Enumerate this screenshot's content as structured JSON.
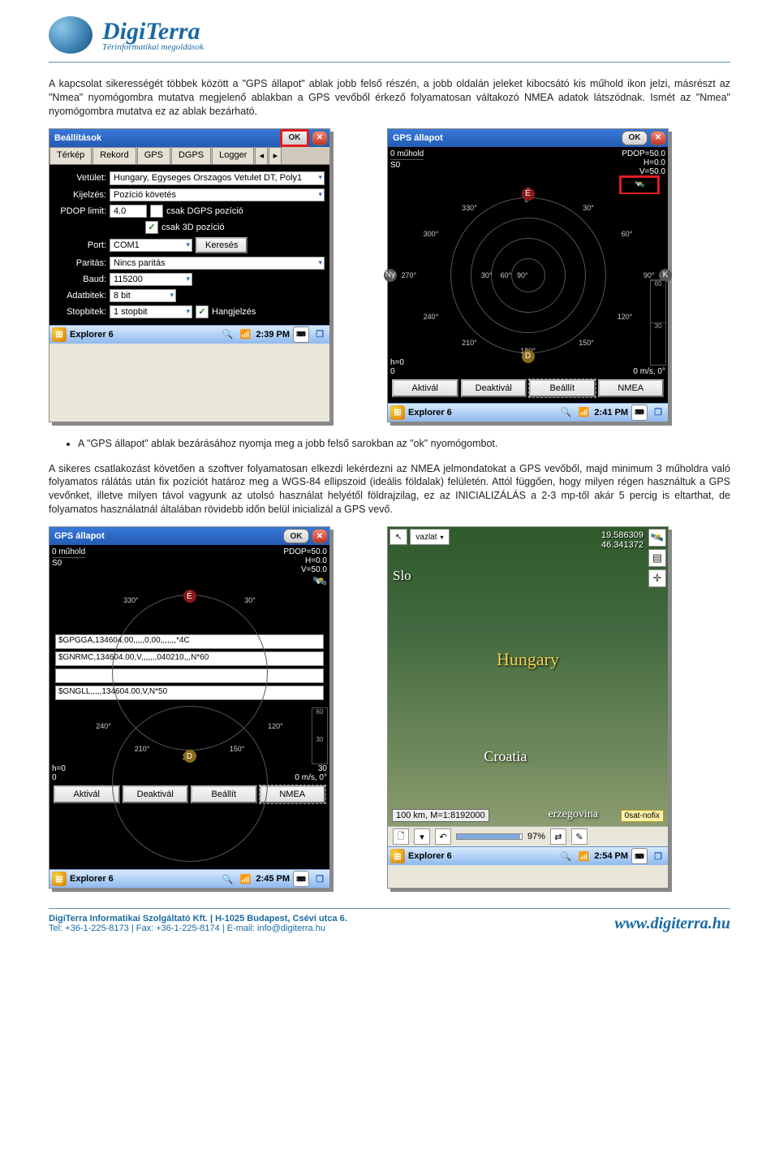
{
  "logo": {
    "title": "DigiTerra",
    "subtitle": "Térinformatikai megoldások"
  },
  "para1": "A kapcsolat sikerességét többek között a \"GPS állapot\" ablak jobb felső részén, a jobb oldalán jeleket kibocsátó kis műhold ikon jelzi, másrészt az \"Nmea\" nyomógombra mutatva megjelenő ablakban a GPS vevőből érkező folyamatosan váltakozó NMEA adatok látszódnak. Ismét az \"Nmea\" nyomógombra mutatva ez az ablak bezárható.",
  "bullet1": "A \"GPS állapot\" ablak bezárásához nyomja meg a jobb felső sarokban az \"ok\" nyomógombot.",
  "para2": "A sikeres csatlakozást követően a szoftver folyamatosan elkezdi lekérdezni az NMEA jelmondatokat a GPS vevőből, majd minimum 3 műholdra való folyamatos rálátás után fix pozíciót határoz meg a WGS-84 ellipszoid (ideális földalak) felületén. Attól függően, hogy milyen régen használtuk a GPS vevőnket, illetve milyen távol vagyunk az utolsó használat helyétől földrajzilag, ez az INICIALIZÁLÁS a 2-3 mp-től akár 5 percig is eltarthat, de folyamatos használatnál általában rövidebb időn belül inicializál a GPS vevő.",
  "settings": {
    "title": "Beállítások",
    "ok": "OK",
    "tabs": [
      "Térkép",
      "Rekord",
      "GPS",
      "DGPS",
      "Logger"
    ],
    "labels": {
      "vetulet": "Vetület:",
      "kijelzes": "Kijelzés:",
      "pdop": "PDOP limit:",
      "port": "Port:",
      "paritas": "Paritás:",
      "baud": "Baud:",
      "adatbitek": "Adatbitek:",
      "stopbitek": "Stopbitek:"
    },
    "values": {
      "vetulet": "Hungary, Egyseges Orszagos Vetulet DT, Poly1",
      "kijelzes": "Pozíció követés",
      "pdop": "4.0",
      "csak_dgps": "csak DGPS pozíció",
      "csak_3d": "csak 3D pozíció",
      "port": "COM1",
      "kereses": "Keresés",
      "paritas": "Nincs paritás",
      "baud": "115200",
      "adatbitek": "8 bit",
      "stopbitek": "1 stopbit",
      "hangjelzes": "Hangjelzés"
    },
    "task": {
      "app": "Explorer 6",
      "time": "2:39 PM"
    }
  },
  "gps1": {
    "title": "GPS állapot",
    "ok": "OK",
    "top": {
      "muhold": "0 műhold",
      "pdop": "PDOP=50.0",
      "h": "H=0.0",
      "s0": "S0",
      "v": "V=50.0"
    },
    "angles": {
      "outer": [
        "330°",
        "0°",
        "30°",
        "300°",
        "60°",
        "270°",
        "90°",
        "240°",
        "120°",
        "210°",
        "180°",
        "150°"
      ],
      "inner": [
        "30°",
        "60°",
        "90°"
      ]
    },
    "cardinals": {
      "n": "É",
      "s": "D",
      "e": "K",
      "w": "Ny"
    },
    "sig": {
      "top": "60",
      "bot": "30"
    },
    "bot": {
      "h0": "h=0",
      "zero1": "0",
      "zero2": "0",
      "speed": "0 m/s, 0°",
      "bar30": "30"
    },
    "buttons": {
      "aktival": "Aktivál",
      "deaktival": "Deaktivál",
      "beallit": "Beállít",
      "nmea": "NMEA"
    },
    "task": {
      "app": "Explorer 6",
      "time": "2:41 PM"
    }
  },
  "gps2": {
    "title": "GPS állapot",
    "ok": "OK",
    "top": {
      "muhold": "0 műhold",
      "pdop": "PDOP=50.0",
      "h": "H=0.0",
      "s0": "S0",
      "v": "V=50.0"
    },
    "nmea": {
      "l1": "$GPGGA,134604.00,,,,,0,00,,,,,,,*4C",
      "l2": "$GNRMC,134604.00,V,,,,,,,040210,,,N*60",
      "l3": "",
      "l4": "$GNGLL,,,,,134604.00,V,N*50"
    },
    "partial_angles": [
      "240°",
      "180°",
      "120°",
      "210°",
      "150°"
    ],
    "bot": {
      "h0": "h=0",
      "zero1": "0",
      "zero2": "0",
      "speed": "0 m/s, 0°",
      "bar30": "30"
    },
    "buttons": {
      "aktival": "Aktivál",
      "deaktival": "Deaktivál",
      "beallit": "Beállít",
      "nmea": "NMEA"
    },
    "task": {
      "app": "Explorer 6",
      "time": "2:45 PM"
    }
  },
  "map": {
    "layer": "vazlat",
    "coords": {
      "lon": "19.586309",
      "lat": "46.341372"
    },
    "labels": {
      "slo": "Slo",
      "hungary": "Hungary",
      "croatia": "Croatia",
      "erz": "erzegovina"
    },
    "scale": "100 km, M=1:8192000",
    "nofix": "0sat-nofix",
    "zoom_pct": "97%",
    "task": {
      "app": "Explorer 6",
      "time": "2:54 PM"
    }
  },
  "footer": {
    "line1": "DigiTerra Informatikai Szolgáltató Kft.   |   H-1025 Budapest, Csévi utca 6.",
    "line2": "Tel: +36-1-225-8173   |   Fax: +36-1-225-8174   |   E-mail: info@digiterra.hu",
    "url": "www.digiterra.hu"
  }
}
